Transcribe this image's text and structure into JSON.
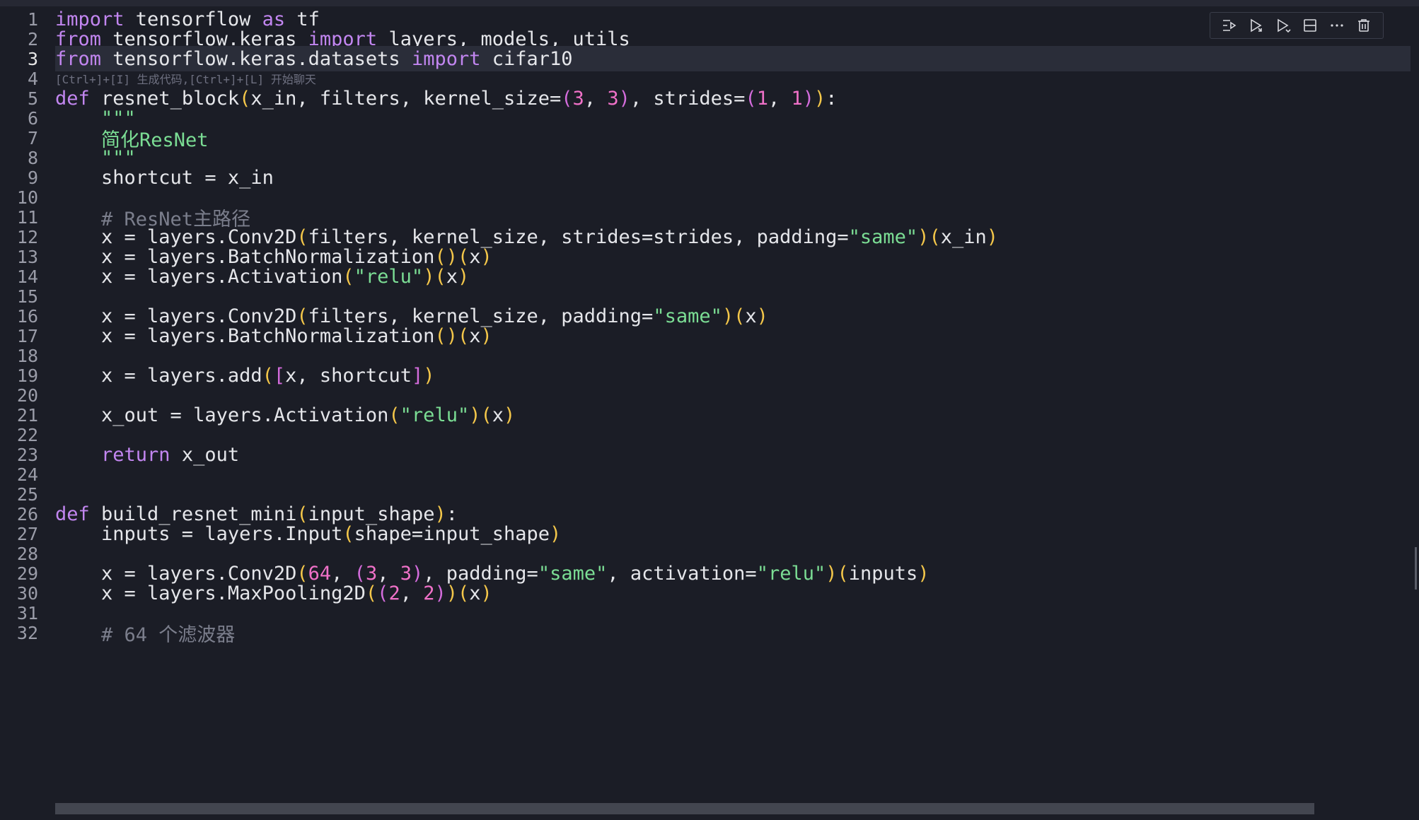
{
  "toolbar": {
    "items": [
      {
        "icon": "execute-above-icon"
      },
      {
        "icon": "run-cell-icon"
      },
      {
        "icon": "run-below-icon"
      },
      {
        "icon": "split-cell-icon"
      },
      {
        "icon": "more-icon"
      },
      {
        "icon": "delete-icon"
      }
    ]
  },
  "editor": {
    "current_line": 3,
    "hint_text": "[Ctrl+]+[I] 生成代码,[Ctrl+]+[L] 开始聊天",
    "lines": [
      {
        "n": "1"
      },
      {
        "n": "2"
      },
      {
        "n": "3"
      },
      {
        "n": "4"
      },
      {
        "n": "5"
      },
      {
        "n": "6"
      },
      {
        "n": "7"
      },
      {
        "n": "8"
      },
      {
        "n": "9"
      },
      {
        "n": "10"
      },
      {
        "n": "11"
      },
      {
        "n": "12"
      },
      {
        "n": "13"
      },
      {
        "n": "14"
      },
      {
        "n": "15"
      },
      {
        "n": "16"
      },
      {
        "n": "17"
      },
      {
        "n": "18"
      },
      {
        "n": "19"
      },
      {
        "n": "20"
      },
      {
        "n": "21"
      },
      {
        "n": "22"
      },
      {
        "n": "23"
      },
      {
        "n": "24"
      },
      {
        "n": "25"
      },
      {
        "n": "26"
      },
      {
        "n": "27"
      },
      {
        "n": "28"
      },
      {
        "n": "29"
      },
      {
        "n": "30"
      },
      {
        "n": "31"
      },
      {
        "n": "32"
      }
    ],
    "code": {
      "l1": {
        "kw1": "import",
        "t1": " tensorflow ",
        "kw2": "as",
        "t2": " tf"
      },
      "l2": {
        "kw1": "from",
        "t1": " tensorflow.keras ",
        "kw2": "import",
        "t2": " layers, models, utils"
      },
      "l3": {
        "kw1": "from",
        "t1": " tensorflow.keras.datasets ",
        "kw2": "import",
        "t2": " cifar10"
      },
      "l5": {
        "kw": "def",
        "name": " resnet_block",
        "p1": "(",
        "args": "x_in, filters, kernel_size=",
        "p2": "(",
        "n1": "3",
        "c1": ", ",
        "n2": "3",
        "p3": ")",
        "s1": ", strides=",
        "p4": "(",
        "n3": "1",
        "c2": ", ",
        "n4": "1",
        "p5": ")",
        "p6": ")",
        "end": ":"
      },
      "l6": {
        "doc": "    \"\"\""
      },
      "l7": {
        "doc": "    简化ResNet"
      },
      "l8": {
        "doc": "    \"\"\""
      },
      "l9": {
        "t": "    shortcut = x_in"
      },
      "l11": {
        "cmt": "    # ResNet主路径"
      },
      "l12": {
        "t1": "    x = layers.Conv2D",
        "p1": "(",
        "t2": "filters, kernel_size, strides=strides, padding=",
        "s": "\"same\"",
        "p2": ")",
        "p3": "(",
        "t3": "x_in",
        "p4": ")"
      },
      "l13": {
        "t1": "    x = layers.BatchNormalization",
        "p1": "()",
        "p2": "(",
        "t2": "x",
        "p3": ")"
      },
      "l14": {
        "t1": "    x = layers.Activation",
        "p1": "(",
        "s": "\"relu\"",
        "p2": ")",
        "p3": "(",
        "t2": "x",
        "p4": ")"
      },
      "l16": {
        "t1": "    x = layers.Conv2D",
        "p1": "(",
        "t2": "filters, kernel_size, padding=",
        "s": "\"same\"",
        "p2": ")",
        "p3": "(",
        "t3": "x",
        "p4": ")"
      },
      "l17": {
        "t1": "    x = layers.BatchNormalization",
        "p1": "()",
        "p2": "(",
        "t2": "x",
        "p3": ")"
      },
      "l19": {
        "t1": "    x = layers.add",
        "p1": "(",
        "b1": "[",
        "t2": "x, shortcut",
        "b2": "]",
        "p2": ")"
      },
      "l21": {
        "t1": "    x_out = layers.Activation",
        "p1": "(",
        "s": "\"relu\"",
        "p2": ")",
        "p3": "(",
        "t2": "x",
        "p4": ")"
      },
      "l23": {
        "kw": "    return",
        "t": " x_out"
      },
      "l26": {
        "kw": "def",
        "name": " build_resnet_mini",
        "p1": "(",
        "t": "input_shape",
        "p2": ")",
        "end": ":"
      },
      "l27": {
        "t1": "    inputs = layers.Input",
        "p1": "(",
        "t2": "shape=input_shape",
        "p2": ")"
      },
      "l29": {
        "t1": "    x = layers.Conv2D",
        "p1": "(",
        "n1": "64",
        "t2": ", ",
        "p2": "(",
        "n2": "3",
        "c": ", ",
        "n3": "3",
        "p3": ")",
        "t3": ", padding=",
        "s1": "\"same\"",
        "t4": ", activation=",
        "s2": "\"relu\"",
        "p4": ")",
        "p5": "(",
        "t5": "inputs",
        "p6": ")"
      },
      "l30": {
        "t1": "    x = layers.MaxPooling2D",
        "p1": "(",
        "p2": "(",
        "n1": "2",
        "c": ", ",
        "n2": "2",
        "p3": ")",
        "p4": ")",
        "p5": "(",
        "t2": "x",
        "p6": ")"
      },
      "l32": {
        "cmt": "    # 64 个滤波器"
      }
    }
  }
}
